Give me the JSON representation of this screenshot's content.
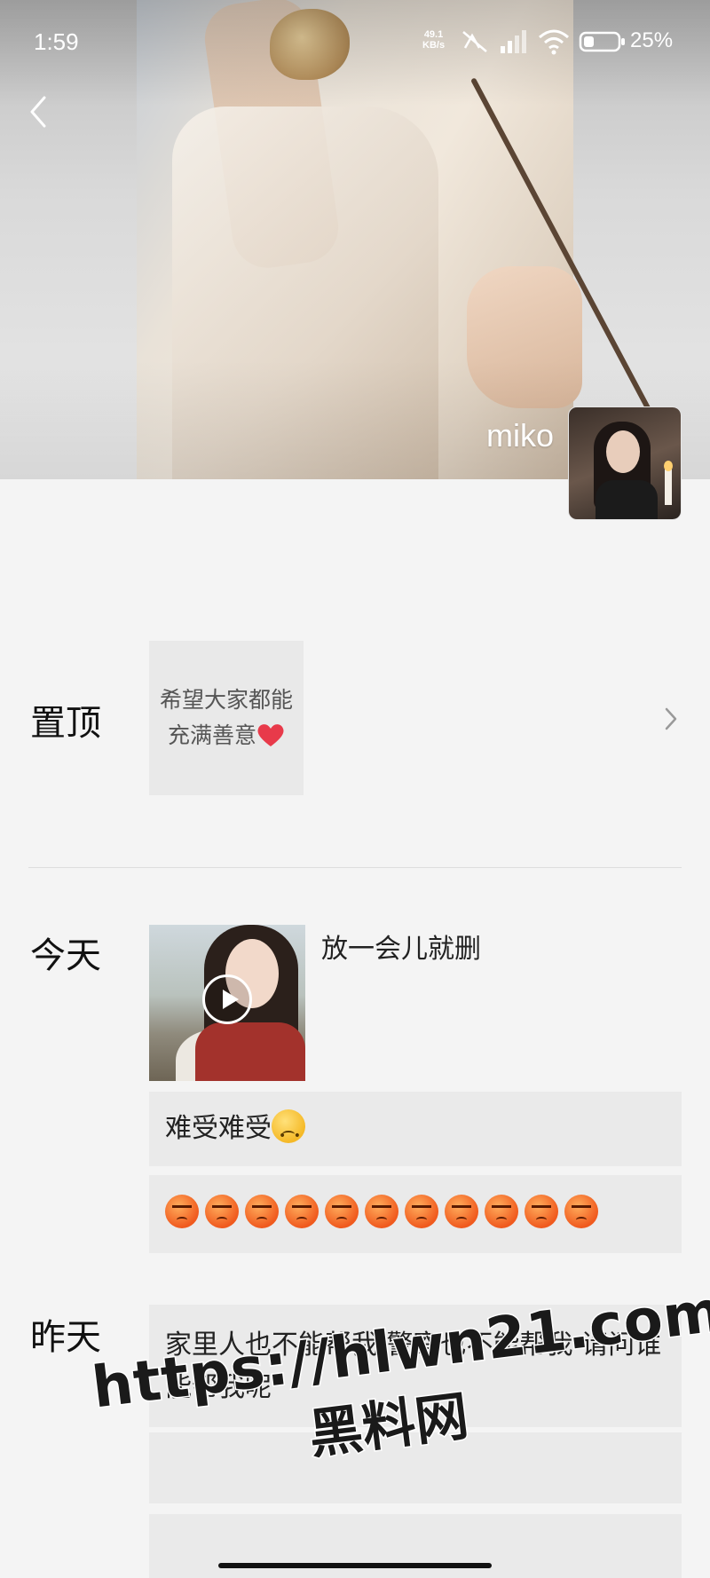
{
  "status_bar": {
    "time": "1:59",
    "net_speed_value": "49.1",
    "net_speed_unit": "KB/s",
    "battery": "25%",
    "icons": [
      "nfc-icon",
      "mute-icon",
      "signal-icon",
      "wifi-icon",
      "battery-icon"
    ]
  },
  "header": {
    "back_icon": "chevron-left-icon",
    "username": "miko"
  },
  "pinned": {
    "label": "置顶",
    "text": "希望大家都能充满善意",
    "icon": "heart-icon",
    "heart_color": "#e83a4a"
  },
  "today": {
    "label": "今天",
    "video_caption": "放一会儿就删",
    "post_1": "难受难受",
    "post_2_angry_count": 11
  },
  "yesterday": {
    "label": "昨天",
    "post_1": "家里人也不能帮我 警察也不能帮我 请问谁能帮我呢"
  },
  "watermark": {
    "url": "https://hlwn21.com",
    "name": "黑料网"
  },
  "colors": {
    "page_bg": "#f4f4f4",
    "card_bg": "#eaeaea",
    "text": "#1a1a1a"
  }
}
